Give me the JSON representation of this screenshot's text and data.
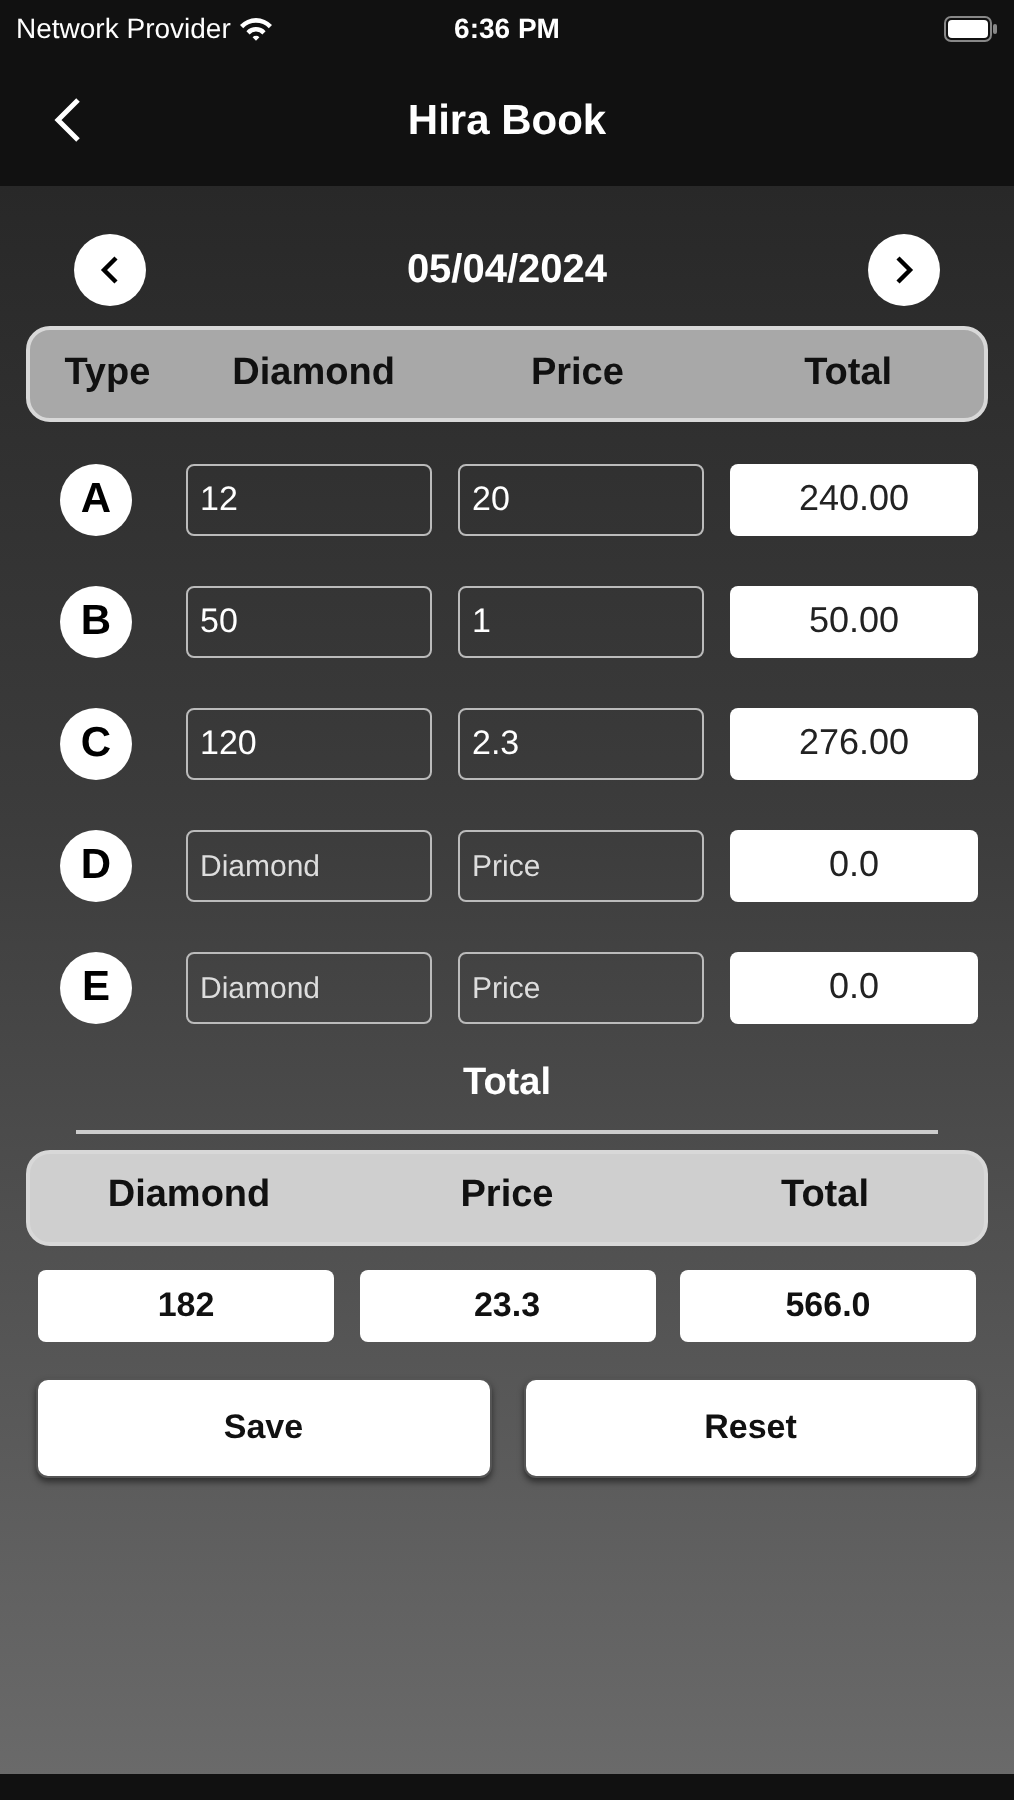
{
  "status_bar": {
    "carrier": "Network Provider",
    "time": "6:36 PM"
  },
  "nav": {
    "title": "Hira Book"
  },
  "date": "05/04/2024",
  "columns": [
    "Type",
    "Diamond",
    "Price",
    "Total"
  ],
  "rows": [
    {
      "type": "A",
      "diamond": {
        "value": "12"
      },
      "price": {
        "value": "20"
      },
      "total": "240.00"
    },
    {
      "type": "B",
      "diamond": {
        "value": "50"
      },
      "price": {
        "value": "1"
      },
      "total": "50.00"
    },
    {
      "type": "C",
      "diamond": {
        "value": "120"
      },
      "price": {
        "value": "2.3"
      },
      "total": "276.00"
    },
    {
      "type": "D",
      "diamond": {
        "placeholder": "Diamond"
      },
      "price": {
        "placeholder": "Price"
      },
      "total": "0.0"
    },
    {
      "type": "E",
      "diamond": {
        "placeholder": "Diamond"
      },
      "price": {
        "placeholder": "Price"
      },
      "total": "0.0"
    }
  ],
  "summary": {
    "title": "Total",
    "columns": [
      "Diamond",
      "Price",
      "Total"
    ],
    "values": [
      "182",
      "23.3",
      "566.0"
    ]
  },
  "buttons": [
    "Save",
    "Reset"
  ]
}
